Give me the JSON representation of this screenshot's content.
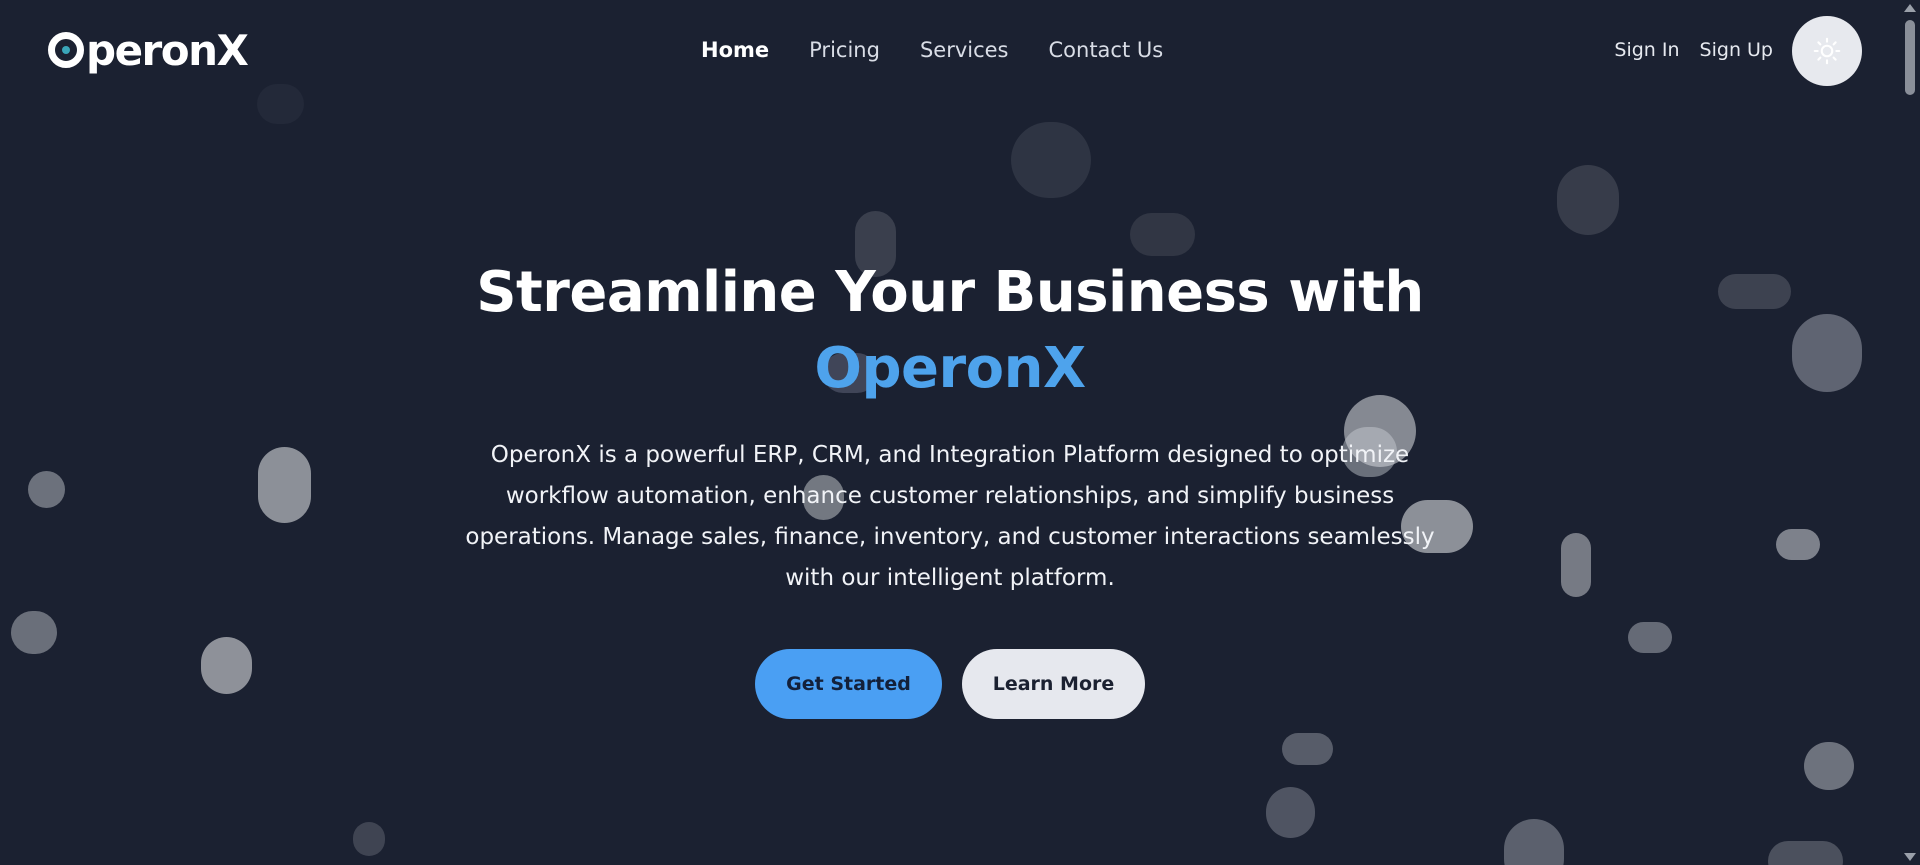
{
  "nav": {
    "logo_text": "peronX",
    "links": [
      {
        "label": "Home",
        "active": true
      },
      {
        "label": "Pricing",
        "active": false
      },
      {
        "label": "Services",
        "active": false
      },
      {
        "label": "Contact Us",
        "active": false
      }
    ],
    "sign_in": "Sign In",
    "sign_up": "Sign Up",
    "theme_toggle_icon": "sun-icon"
  },
  "hero": {
    "title_line1": "Streamline Your Business with",
    "title_accent": "OperonX",
    "description": "OperonX is a powerful ERP, CRM, and Integration Platform designed to optimize workflow automation, enhance customer relationships, and simplify business operations. Manage sales, finance, inventory, and customer interactions seamlessly with our intelligent platform.",
    "primary_button": "Get Started",
    "secondary_button": "Learn More"
  },
  "colors": {
    "background": "#1b2131",
    "accent": "#4ea3ec",
    "primary_button": "#4a9ff3",
    "secondary_button": "#e6e8ee"
  }
}
